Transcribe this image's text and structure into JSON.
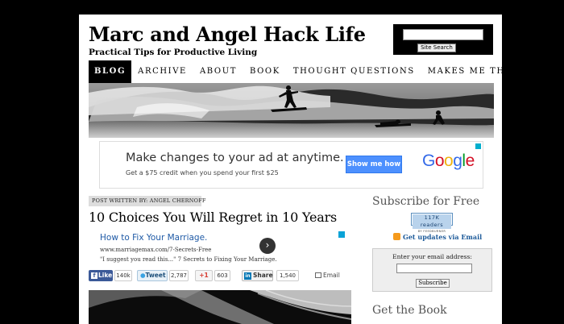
{
  "header": {
    "title": "Marc and Angel Hack Life",
    "tagline": "Practical Tips for Productive Living"
  },
  "search": {
    "placeholder": "",
    "button_label": "Site Search"
  },
  "nav": {
    "items": [
      {
        "label": "BLOG"
      },
      {
        "label": "ARCHIVE"
      },
      {
        "label": "ABOUT"
      },
      {
        "label": "BOOK"
      },
      {
        "label": "THOUGHT QUESTIONS"
      },
      {
        "label": "MAKES ME THINK"
      }
    ],
    "active_index": 0
  },
  "ad_banner": {
    "headline": "Make changes to your ad at anytime.",
    "subline": "Get a $75 credit when you spend your first $25",
    "button_label": "Show me how",
    "brand": "Google",
    "brand_colors": [
      "#3369e8",
      "#d50f25",
      "#eeb211",
      "#3369e8",
      "#009925",
      "#d50f25"
    ]
  },
  "post": {
    "author_line": "POST WRITTEN BY: ANGEL CHERNOFF",
    "title": "10 Choices You Will Regret in 10 Years"
  },
  "text_ad": {
    "title": "How to Fix Your Marriage.",
    "url": "www.marriagemax.com/7-Secrets-Free",
    "description": "\"I suggest you read this...\" 7 Secrets to Fixing Your Marriage."
  },
  "share": {
    "facebook_label": "Like",
    "facebook_count": "140k",
    "twitter_label": "Tweet",
    "twitter_count": "2,787",
    "gplus_label": "+1",
    "gplus_count": "603",
    "linkedin_label": "Share",
    "linkedin_count": "1,540",
    "email_label": "Email"
  },
  "sidebar": {
    "subscribe_title": "Subscribe for Free",
    "feedburner_count": "117K readers",
    "feedburner_by": "BY FEEDBURNER",
    "email_updates_label": "Get updates via Email",
    "email_prompt": "Enter your email address:",
    "subscribe_button": "Subscribe",
    "book_title": "Get the Book"
  },
  "colors": {
    "accent_blue": "#1e5b9a",
    "facebook": "#3b5998",
    "ad_button": "#4d90fe"
  }
}
